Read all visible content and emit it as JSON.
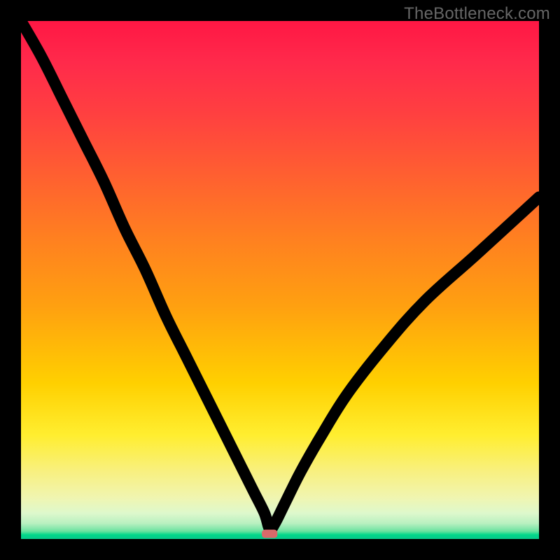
{
  "watermark": "TheBottleneck.com",
  "chart_data": {
    "type": "line",
    "title": "",
    "xlabel": "",
    "ylabel": "",
    "xlim": [
      0,
      100
    ],
    "ylim": [
      0,
      100
    ],
    "grid": false,
    "legend": false,
    "background_gradient": {
      "top_color": "#ff1744",
      "bottom_color": "#09c78a",
      "description": "red-to-green vertical gradient (high bottleneck = red, low/optimal = green)"
    },
    "optimal_marker": {
      "x": 48,
      "y": 1,
      "color": "#d86a6a",
      "shape": "rounded-rect"
    },
    "series": [
      {
        "name": "bottleneck-curve",
        "color": "#000000",
        "x": [
          0,
          4,
          8,
          12,
          16,
          20,
          24,
          28,
          32,
          36,
          40,
          43,
          45,
          47,
          48,
          49,
          51,
          54,
          58,
          63,
          70,
          78,
          88,
          100
        ],
        "y": [
          100,
          93,
          85,
          77,
          69,
          60,
          52,
          43,
          35,
          27,
          19,
          13,
          9,
          5,
          2,
          3,
          7,
          13,
          20,
          28,
          37,
          46,
          55,
          66
        ]
      }
    ]
  }
}
